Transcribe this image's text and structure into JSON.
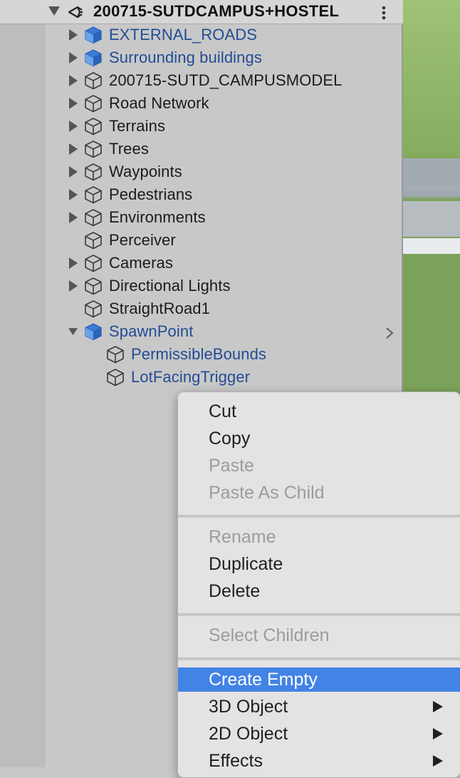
{
  "scene": {
    "title": "200715-SUTDCAMPUS+HOSTEL",
    "unity_icon": "unity-logo-icon",
    "more_icon": "kebab-menu-icon"
  },
  "hierarchy": {
    "items": [
      {
        "label": "EXTERNAL_ROADS",
        "expand": "collapsed",
        "prefab": true
      },
      {
        "label": "Surrounding buildings",
        "expand": "collapsed",
        "prefab": true
      },
      {
        "label": "200715-SUTD_CAMPUSMODEL",
        "expand": "collapsed",
        "prefab": false
      },
      {
        "label": "Road Network",
        "expand": "collapsed",
        "prefab": false
      },
      {
        "label": "Terrains",
        "expand": "collapsed",
        "prefab": false
      },
      {
        "label": "Trees",
        "expand": "collapsed",
        "prefab": false
      },
      {
        "label": "Waypoints",
        "expand": "collapsed",
        "prefab": false
      },
      {
        "label": "Pedestrians",
        "expand": "collapsed",
        "prefab": false
      },
      {
        "label": "Environments",
        "expand": "collapsed",
        "prefab": false
      },
      {
        "label": "Perceiver",
        "expand": "none",
        "prefab": false
      },
      {
        "label": "Cameras",
        "expand": "collapsed",
        "prefab": false
      },
      {
        "label": "Directional Lights",
        "expand": "collapsed",
        "prefab": false
      },
      {
        "label": "StraightRoad1",
        "expand": "none",
        "prefab": false
      },
      {
        "label": "SpawnPoint",
        "expand": "expanded",
        "prefab": true
      },
      {
        "label": "PermissibleBounds",
        "expand": "none",
        "prefab": true
      },
      {
        "label": "LotFacingTrigger",
        "expand": "none",
        "prefab": true
      }
    ]
  },
  "context_menu": {
    "items": [
      {
        "label": "Cut",
        "enabled": true
      },
      {
        "label": "Copy",
        "enabled": true
      },
      {
        "label": "Paste",
        "enabled": false
      },
      {
        "label": "Paste As Child",
        "enabled": false
      },
      {
        "label": "Rename",
        "enabled": false
      },
      {
        "label": "Duplicate",
        "enabled": true
      },
      {
        "label": "Delete",
        "enabled": true
      },
      {
        "label": "Select Children",
        "enabled": false
      },
      {
        "label": "Create Empty",
        "enabled": true,
        "highlighted": true
      },
      {
        "label": "3D Object",
        "enabled": true,
        "submenu": true
      },
      {
        "label": "2D Object",
        "enabled": true,
        "submenu": true
      },
      {
        "label": "Effects",
        "enabled": true,
        "submenu": true
      }
    ]
  },
  "colors": {
    "prefab_text": "#234c94",
    "prefab_cube": "#2f6fd1",
    "highlight": "#4283e6",
    "disabled_text": "#9c9c9c"
  }
}
